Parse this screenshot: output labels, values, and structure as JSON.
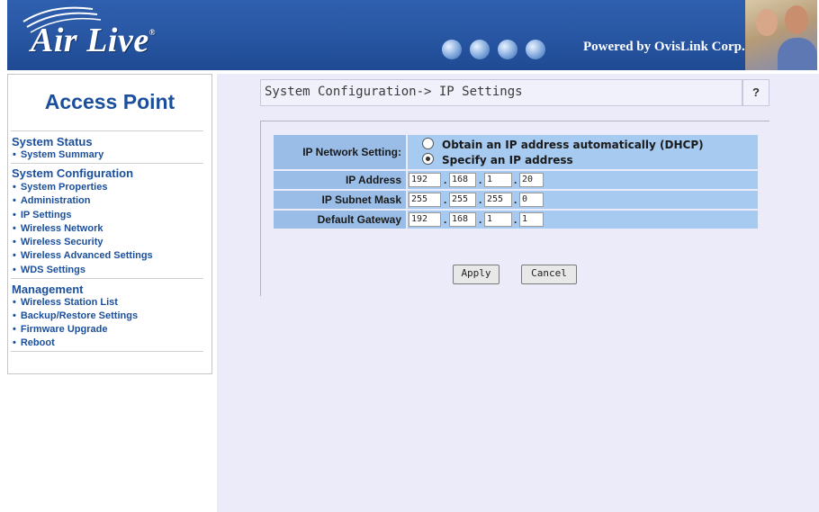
{
  "header": {
    "logo_text": "Air Live",
    "logo_mark": "®",
    "powered_text": "Powered by OvisLink Corp.",
    "icons": [
      "globe-icon",
      "globe-icon",
      "globe-icon",
      "globe-icon"
    ],
    "colors": {
      "banner": "#2a59a6",
      "accent": "#1b4f9c",
      "main_bg": "#ebebfa",
      "label_bg": "#99bde6",
      "value_bg": "#a7cbf0"
    }
  },
  "sidebar": {
    "title": "Access Point",
    "sections": [
      {
        "heading": "System Status",
        "items": [
          "System Summary"
        ]
      },
      {
        "heading": "System Configuration",
        "items": [
          "System Properties",
          "Administration",
          "IP Settings",
          "Wireless Network",
          "Wireless Security",
          "Wireless Advanced Settings",
          "WDS Settings"
        ]
      },
      {
        "heading": "Management",
        "items": [
          "Wireless Station List",
          "Backup/Restore Settings",
          "Firmware Upgrade",
          "Reboot"
        ]
      }
    ]
  },
  "main": {
    "title": "System Configuration-> IP Settings",
    "help": "?",
    "form": {
      "network_setting_label": "IP Network Setting:",
      "option_dhcp": "Obtain an IP address automatically (DHCP)",
      "option_static": "Specify an IP address",
      "selected": "Specify an IP address",
      "ip_address_label": "IP Address",
      "ip_address": [
        "192",
        "168",
        "1",
        "20"
      ],
      "subnet_mask_label": "IP Subnet Mask",
      "subnet_mask": [
        "255",
        "255",
        "255",
        "0"
      ],
      "gateway_label": "Default Gateway",
      "gateway": [
        "192",
        "168",
        "1",
        "1"
      ],
      "dot": "."
    },
    "buttons": {
      "apply": "Apply",
      "cancel": "Cancel"
    }
  }
}
